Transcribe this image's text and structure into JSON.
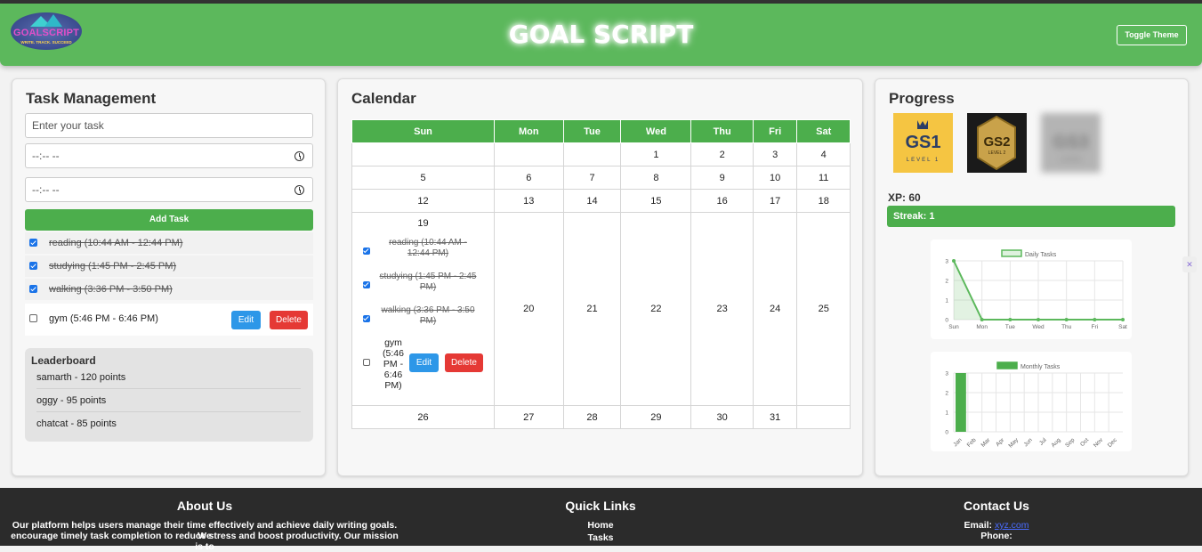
{
  "header": {
    "title": "GOAL SCRIPT",
    "toggle_label": "Toggle Theme",
    "logo_text": "GOALSCRIPT",
    "logo_tagline": "WRITE. TRACK. SUCCEED"
  },
  "tasks_panel": {
    "title": "Task Management",
    "task_input_placeholder": "Enter your task",
    "start_time_value": "--:-- --",
    "end_time_value": "--:-- --",
    "add_button": "Add Task",
    "tasks": [
      {
        "text": "reading (10:44 AM - 12:44 PM)",
        "done": true
      },
      {
        "text": "studying (1:45 PM - 2:45 PM)",
        "done": true
      },
      {
        "text": "walking (3:36 PM - 3:50 PM)",
        "done": true
      },
      {
        "text": "gym (5:46 PM - 6:46 PM)",
        "done": false
      }
    ],
    "edit_label": "Edit",
    "delete_label": "Delete"
  },
  "leaderboard": {
    "title": "Leaderboard",
    "entries": [
      "samarth - 120 points",
      "oggy - 95 points",
      "chatcat - 85 points"
    ]
  },
  "calendar": {
    "title": "Calendar",
    "days": [
      "Sun",
      "Mon",
      "Tue",
      "Wed",
      "Thu",
      "Fri",
      "Sat"
    ],
    "weeks": [
      [
        "",
        "",
        "",
        "1",
        "2",
        "3",
        "4"
      ],
      [
        "5",
        "6",
        "7",
        "8",
        "9",
        "10",
        "11"
      ],
      [
        "12",
        "13",
        "14",
        "15",
        "16",
        "17",
        "18"
      ],
      [
        "19",
        "20",
        "21",
        "22",
        "23",
        "24",
        "25"
      ],
      [
        "26",
        "27",
        "28",
        "29",
        "30",
        "31",
        ""
      ]
    ],
    "cell_tasks": [
      {
        "text": "reading (10:44 AM - 12:44 PM)",
        "done": true
      },
      {
        "text": "studying (1:45 PM - 2:45 PM)",
        "done": true
      },
      {
        "text": "walking (3:36 PM - 3:50 PM)",
        "done": true
      },
      {
        "text": "gym (5:46 PM - 6:46 PM)",
        "done": false
      }
    ],
    "edit_label": "Edit",
    "delete_label": "Delete"
  },
  "progress": {
    "title": "Progress",
    "badges": [
      {
        "text": "GS1",
        "sub": "LEVEL 1"
      },
      {
        "text": "GS2",
        "sub": "LEVEL 2"
      },
      {
        "text": "GS3",
        "sub": "LOCKED"
      }
    ],
    "xp": "XP: 60",
    "streak": "Streak: 1"
  },
  "chart_data": [
    {
      "type": "line",
      "title": "",
      "series": [
        {
          "name": "Daily Tasks",
          "values": [
            3,
            0,
            0,
            0,
            0,
            0,
            0
          ]
        }
      ],
      "categories": [
        "Sun",
        "Mon",
        "Tue",
        "Wed",
        "Thu",
        "Fri",
        "Sat"
      ],
      "ylim": [
        0,
        3
      ],
      "yticks": [
        "0",
        "1",
        "2",
        "3"
      ],
      "legend": "top",
      "color": "#5cb85c"
    },
    {
      "type": "bar",
      "title": "",
      "series": [
        {
          "name": "Monthly Tasks",
          "values": [
            3,
            0,
            0,
            0,
            0,
            0,
            0,
            0,
            0,
            0,
            0,
            0
          ]
        }
      ],
      "categories": [
        "Jan",
        "Feb",
        "Mar",
        "Apr",
        "May",
        "Jun",
        "Jul",
        "Aug",
        "Sep",
        "Oct",
        "Nov",
        "Dec"
      ],
      "ylim": [
        0,
        3
      ],
      "yticks": [
        "0",
        "1",
        "2",
        "3"
      ],
      "legend": "top",
      "color": "#4cae4c"
    }
  ],
  "footer": {
    "about_title": "About Us",
    "about_text_1": "Our platform helps users manage their time effectively and achieve daily writing goals. We",
    "about_text_2": "encourage timely task completion to reduce stress and boost productivity. Our mission is to",
    "links_title": "Quick Links",
    "link_home": "Home",
    "link_tasks": "Tasks",
    "contact_title": "Contact Us",
    "email_label": "Email:",
    "email_value": "xyz.com",
    "phone_label": "Phone:"
  }
}
